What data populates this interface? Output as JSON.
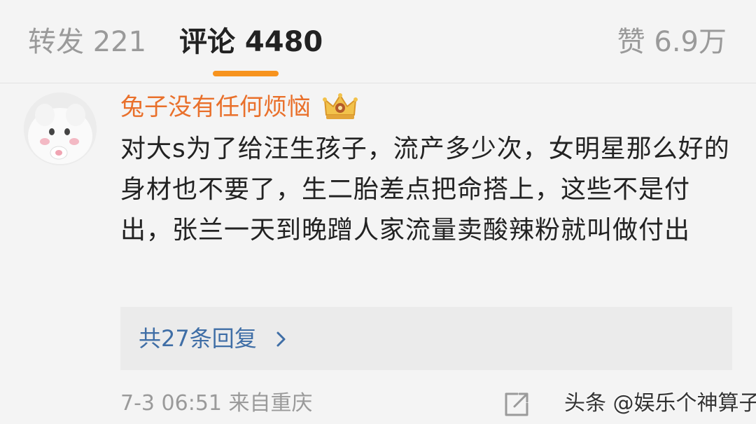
{
  "tabs": {
    "repost": "转发 221",
    "comment": "评论 4480",
    "like": "赞 6.9万"
  },
  "comment": {
    "username": "兔子没有任何烦恼",
    "badge_icon": "crown-icon",
    "text": "对大s为了给汪生孩子，流产多少次，女明星那么好的身材也不要了，生二胎差点把命搭上，这些不是付出，张兰一天到晚蹭人家流量卖酸辣粉就叫做付出",
    "replies_label": "共27条回复",
    "timestamp": "7-3 06:51 来自重庆"
  },
  "watermark": "头条 @娱乐个神算子",
  "colors": {
    "accent": "#f7931e",
    "username": "#e9702b",
    "link": "#3f6ea6",
    "muted": "#9a9a9a",
    "background": "#f4f4f4"
  }
}
